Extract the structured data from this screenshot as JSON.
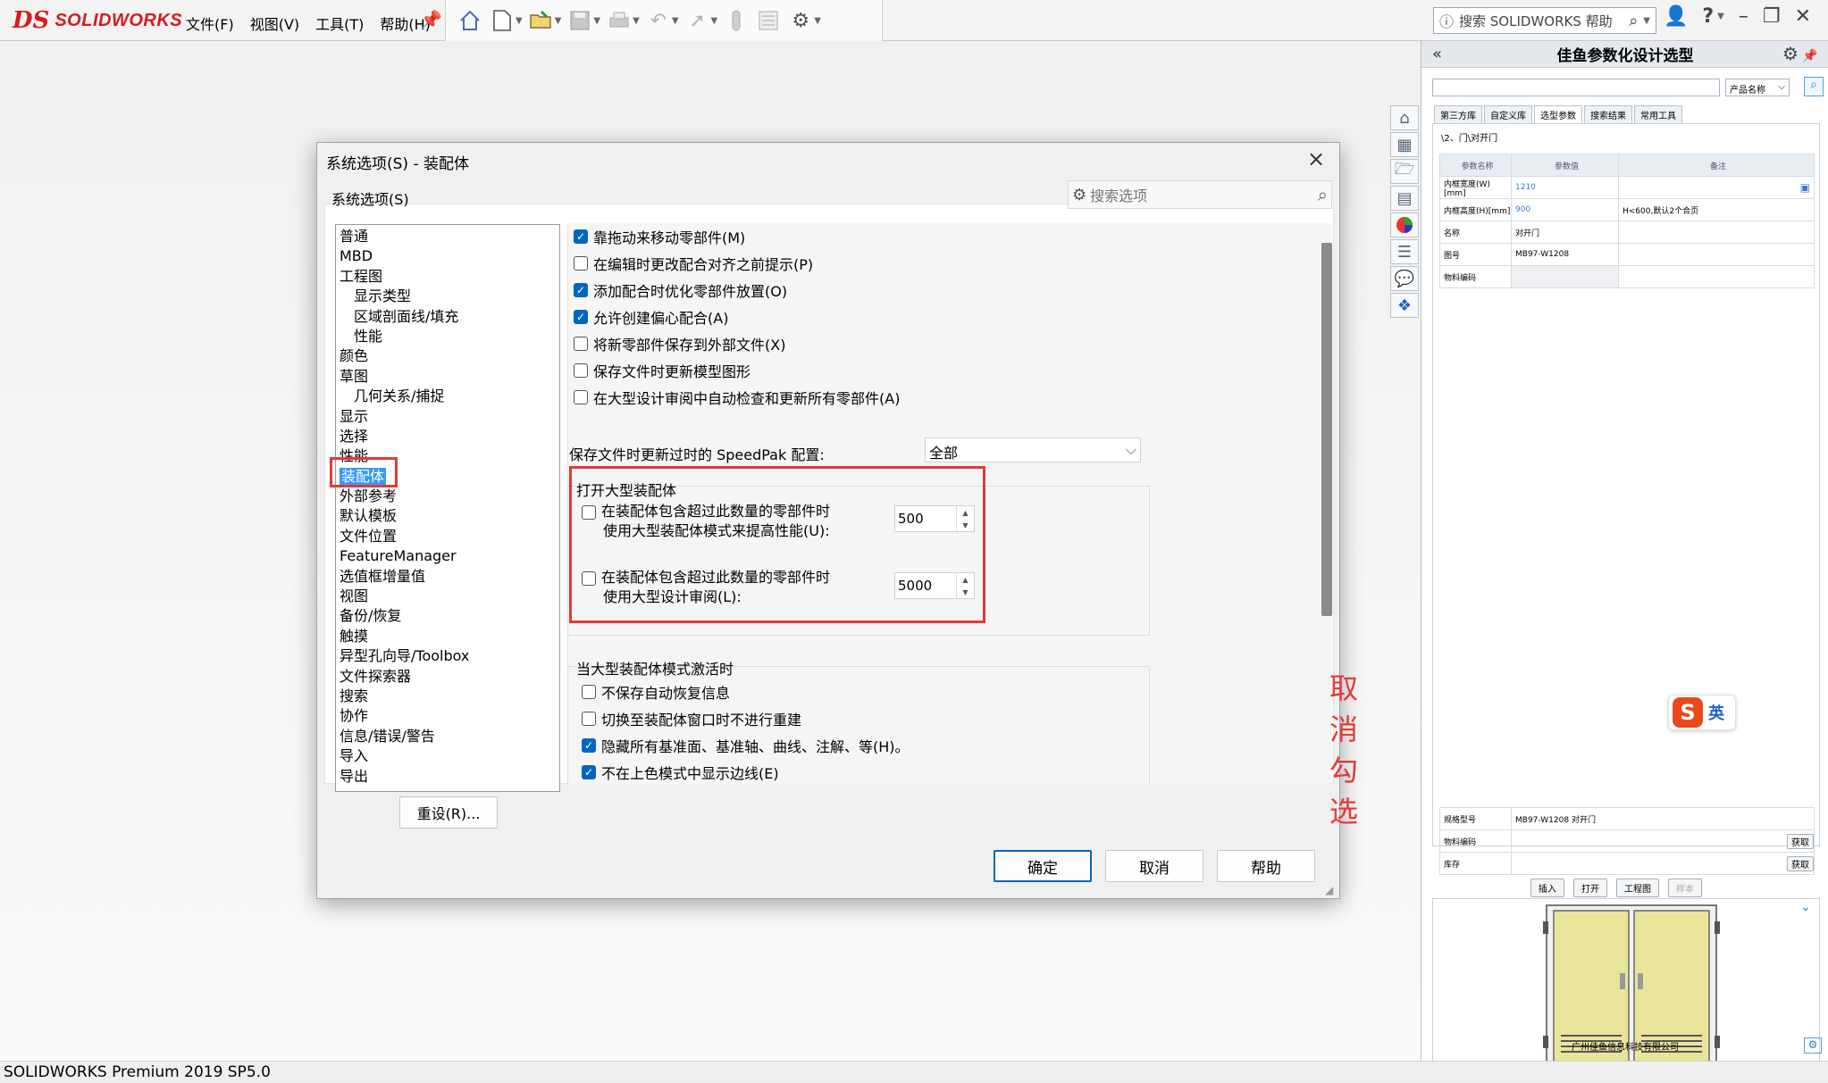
{
  "app": {
    "brand_ds": "DS",
    "brand_name": "SOLIDWORKS",
    "menu": [
      "文件(F)",
      "视图(V)",
      "工具(T)",
      "帮助(H)"
    ],
    "search_placeholder": "搜索 SOLIDWORKS 帮助",
    "status": "SOLIDWORKS Premium 2019 SP5.0",
    "accent": "#0067c0",
    "brand_color": "#d71920"
  },
  "dialog": {
    "title": "系统选项(S) - 装配体",
    "close": "×",
    "search_placeholder": "搜索选项",
    "tab": "系统选项(S)",
    "tree": [
      {
        "label": "普通",
        "sub": false
      },
      {
        "label": "MBD",
        "sub": false
      },
      {
        "label": "工程图",
        "sub": false
      },
      {
        "label": "显示类型",
        "sub": true
      },
      {
        "label": "区域剖面线/填充",
        "sub": true
      },
      {
        "label": "性能",
        "sub": true
      },
      {
        "label": "颜色",
        "sub": false
      },
      {
        "label": "草图",
        "sub": false
      },
      {
        "label": "几何关系/捕捉",
        "sub": true
      },
      {
        "label": "显示",
        "sub": false
      },
      {
        "label": "选择",
        "sub": false
      },
      {
        "label": "性能",
        "sub": false
      },
      {
        "label": "装配体",
        "sub": false,
        "selected": true
      },
      {
        "label": "外部参考",
        "sub": false
      },
      {
        "label": "默认模板",
        "sub": false
      },
      {
        "label": "文件位置",
        "sub": false
      },
      {
        "label": "FeatureManager",
        "sub": false
      },
      {
        "label": "选值框增量值",
        "sub": false
      },
      {
        "label": "视图",
        "sub": false
      },
      {
        "label": "备份/恢复",
        "sub": false
      },
      {
        "label": "触摸",
        "sub": false
      },
      {
        "label": "异型孔向导/Toolbox",
        "sub": false
      },
      {
        "label": "文件探索器",
        "sub": false
      },
      {
        "label": "搜索",
        "sub": false
      },
      {
        "label": "协作",
        "sub": false
      },
      {
        "label": "信息/错误/警告",
        "sub": false
      },
      {
        "label": "导入",
        "sub": false
      },
      {
        "label": "导出",
        "sub": false
      }
    ],
    "reset": "重设(R)...",
    "options": [
      {
        "label": "靠拖动来移动零部件(M)",
        "checked": true
      },
      {
        "label": "在编辑时更改配合对齐之前提示(P)",
        "checked": false
      },
      {
        "label": "添加配合时优化零部件放置(O)",
        "checked": true
      },
      {
        "label": "允许创建偏心配合(A)",
        "checked": true
      },
      {
        "label": "将新零部件保存到外部文件(X)",
        "checked": false
      },
      {
        "label": "保存文件时更新模型图形",
        "checked": false
      },
      {
        "label": "在大型设计审阅中自动检查和更新所有零部件(A)",
        "checked": false
      }
    ],
    "speedpak_label": "保存文件时更新过时的 SpeedPak 配置:",
    "speedpak_value": "全部",
    "large_group": {
      "title": "打开大型装配体",
      "item1_line1": "在装配体包含超过此数量的零部件时",
      "item1_line2": "使用大型装配体模式来提高性能(U):",
      "item1_value": "500",
      "item2_line1": "在装配体包含超过此数量的零部件时",
      "item2_line2": "使用大型设计审阅(L):",
      "item2_value": "5000"
    },
    "active_group": {
      "title": "当大型装配体模式激活时",
      "items": [
        {
          "label": "不保存自动恢复信息",
          "checked": false
        },
        {
          "label": "切换至装配体窗口时不进行重建",
          "checked": false
        },
        {
          "label": "隐藏所有基准面、基准轴、曲线、注解、等(H)。",
          "checked": true
        },
        {
          "label": "不在上色模式中显示边线(E)",
          "checked": true
        }
      ]
    },
    "buttons": {
      "ok": "确定",
      "cancel": "取消",
      "help": "帮助"
    },
    "annotation": "取消勾选",
    "annotation_color": "#e53935"
  },
  "panel": {
    "title": "佳鱼参数化设计选型",
    "collapse": "«",
    "dropdown": "产品名称",
    "tabs": [
      "第三方库",
      "自定义库",
      "选型参数",
      "搜索结果",
      "常用工具"
    ],
    "path": "\\2、门\\对开门",
    "table_headers": [
      "参数名称",
      "参数值",
      "备注"
    ],
    "rows": [
      [
        "内框宽度(W)[mm]",
        "1210",
        ""
      ],
      [
        "内框高度(H)[mm]",
        "900",
        "H<600,默认2个合页"
      ],
      [
        "名称",
        "对开门",
        ""
      ],
      [
        "图号",
        "MB97-W1208",
        ""
      ],
      [
        "物料编码",
        "",
        ""
      ]
    ],
    "ime_label": "英",
    "lower_rows": [
      {
        "label": "规格型号",
        "value": "MB97-W1208 对开门",
        "button": ""
      },
      {
        "label": "物料编码",
        "value": "",
        "button": "获取"
      },
      {
        "label": "库存",
        "value": "",
        "button": "获取"
      }
    ],
    "actions": [
      "插入",
      "打开",
      "工程图",
      "样本"
    ],
    "company": "广州佳鱼信息科技有限公司"
  }
}
